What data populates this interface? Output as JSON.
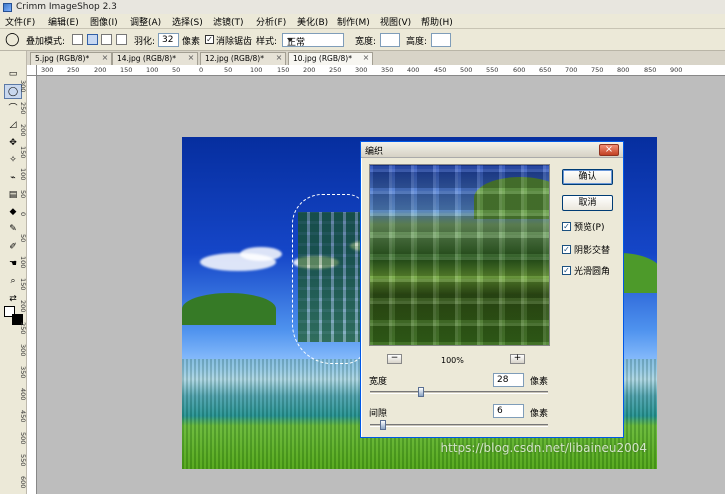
{
  "app": {
    "title": "Crimm ImageShop 2.3"
  },
  "menu": {
    "items": [
      "文件(F)",
      "编辑(E)",
      "图像(I)",
      "调整(A)",
      "选择(S)",
      "滤镜(T)",
      "分析(F)",
      "美化(B)",
      "制作(M)",
      "视图(V)",
      "帮助(H)"
    ]
  },
  "options": {
    "blend_label": "叠加模式:",
    "feather_label": "羽化:",
    "feather_value": "32",
    "feather_unit": "像素",
    "antialias_label": "消除锯齿",
    "style_label": "样式:",
    "style_value": "正常",
    "width_label": "宽度:",
    "width_value": "",
    "height_label": "高度:",
    "height_value": ""
  },
  "tabs": [
    {
      "label": "5.jpg (RGB/8)*"
    },
    {
      "label": "14.jpg (RGB/8)*"
    },
    {
      "label": "12.jpg (RGB/8)*"
    },
    {
      "label": "10.jpg (RGB/8)*"
    }
  ],
  "rulers": {
    "horizontal": [
      "300",
      "250",
      "200",
      "150",
      "100",
      "50",
      "0",
      "50",
      "100",
      "150",
      "200",
      "250",
      "300",
      "350",
      "400",
      "450",
      "500",
      "550",
      "600",
      "650",
      "700",
      "750",
      "800",
      "850",
      "900"
    ],
    "vertical": [
      "300",
      "250",
      "200",
      "150",
      "100",
      "50",
      "0",
      "50",
      "100",
      "150",
      "200",
      "250",
      "300",
      "350",
      "400",
      "450",
      "500",
      "550",
      "600",
      "650"
    ]
  },
  "dialog": {
    "title": "编织",
    "zoom_level": "100%",
    "width_label": "宽度",
    "width_value": "28",
    "width_unit": "像素",
    "gap_label": "间隙",
    "gap_value": "6",
    "gap_unit": "像素",
    "ok_label": "确认",
    "cancel_label": "取消",
    "preview_label": "预览(P)",
    "shadow_label": "阴影交替",
    "smooth_label": "光滑圆角",
    "width_level": 0.28,
    "gap_level": 0.06
  },
  "watermark": "https://blog.csdn.net/libaineu2004"
}
